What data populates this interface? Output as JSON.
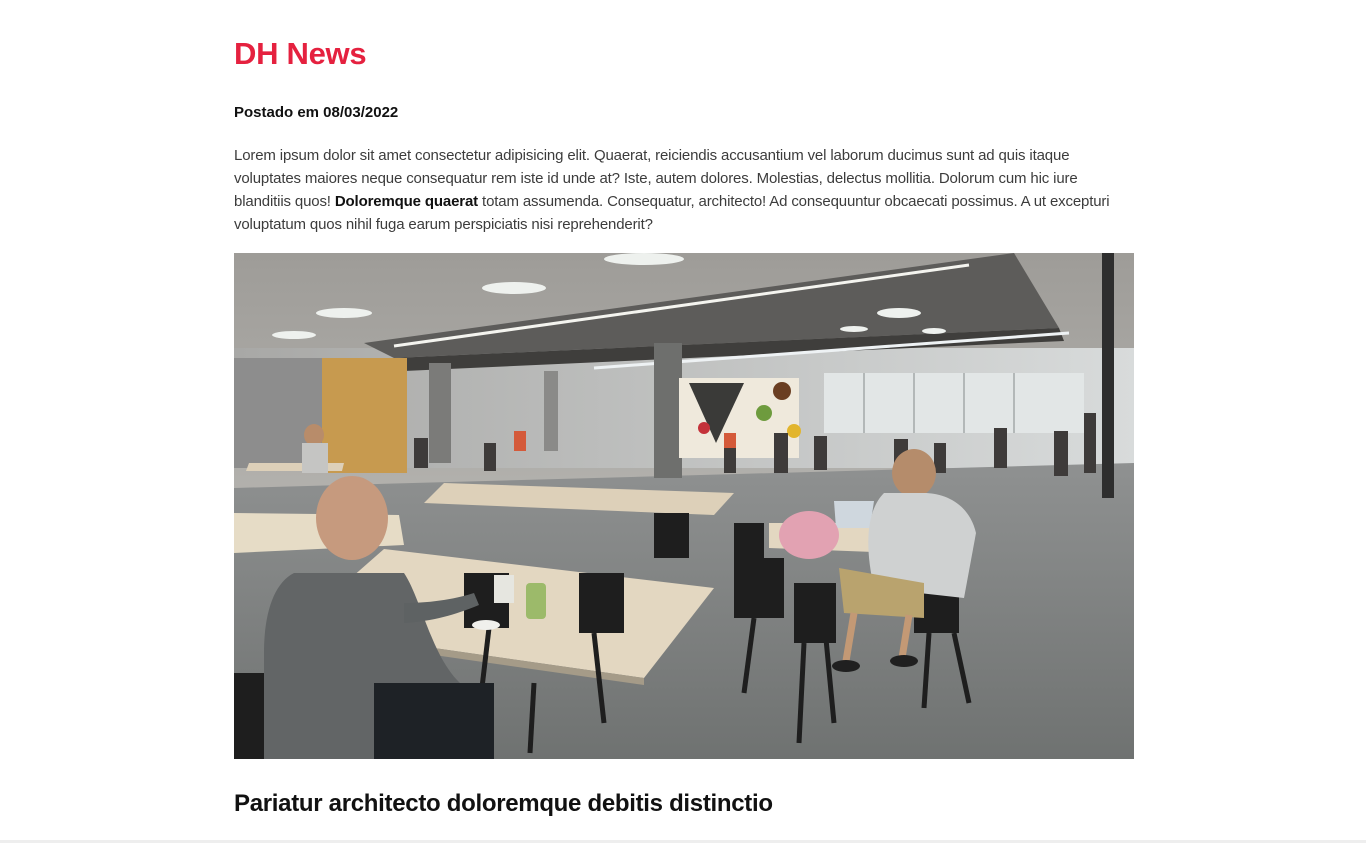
{
  "header": {
    "site_title": "DH News"
  },
  "post": {
    "date_label": "Postado em 08/03/2022",
    "body_before": "Lorem ipsum dolor sit amet consectetur adipisicing elit. Quaerat, reiciendis accusantium vel laborum ducimus sunt ad quis itaque voluptates maiores neque consequatur rem iste id unde at? Iste, autem dolores. Molestias, delectus mollitia. Dolorum cum hic iure blanditiis quos! ",
    "body_bold": "Doloremque quaerat",
    "body_after": " totam assumenda. Consequatur, architecto! Ad consequuntur obcaecati possimus. A ut excepturi voluptatum quos nihil fuga earum perspiciatis nisi reprehenderit?",
    "image_icon": "photo-coworking-cafeteria",
    "subtitle": "Pariatur architecto doloremque debitis distinctio"
  },
  "colors": {
    "brand": "#e5213f"
  }
}
